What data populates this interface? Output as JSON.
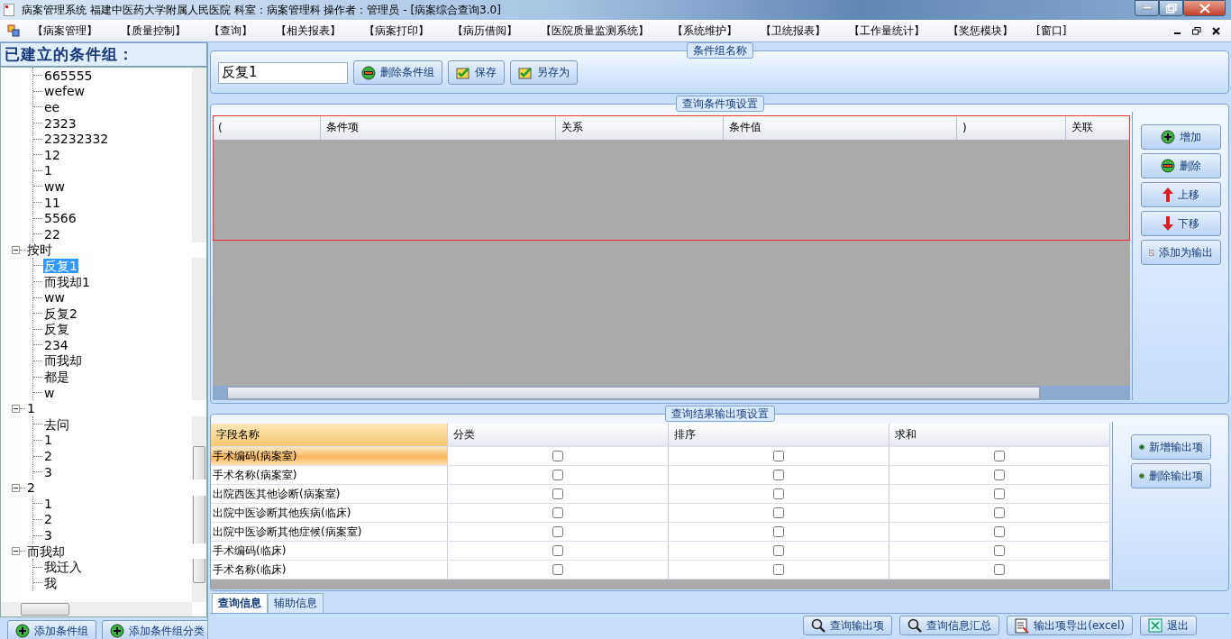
{
  "window": {
    "title": "病案管理系统  福建中医药大学附属人民医院  科室：病案管理科 操作者：管理员 - [病案综合查询3.0]"
  },
  "menu": [
    "【病案管理】",
    "【质量控制】",
    "【查询】",
    "【相关报表】",
    "【病案打印】",
    "【病历借阅】",
    "【医院质量监测系统】",
    "【系统维护】",
    "【卫统报表】",
    "【工作量统计】",
    "【奖惩模块】",
    "[窗口]"
  ],
  "left_panel": {
    "title": "已建立的条件组：",
    "tree": [
      {
        "expanded": true,
        "children": [
          {
            "label": "665555",
            "selected": false
          },
          {
            "label": "wefew",
            "selected": false
          },
          {
            "label": "ee",
            "selected": false
          },
          {
            "label": "2323",
            "selected": false
          },
          {
            "label": "23232332",
            "selected": false
          },
          {
            "label": "12",
            "selected": false
          },
          {
            "label": "1",
            "selected": false
          },
          {
            "label": "ww",
            "selected": false
          },
          {
            "label": "11",
            "selected": false
          },
          {
            "label": "5566",
            "selected": false
          },
          {
            "label": "22",
            "selected": false
          }
        ]
      },
      {
        "label": "按时",
        "expanded": true,
        "children": [
          {
            "label": "反复1",
            "selected": true
          },
          {
            "label": "而我却1",
            "selected": false
          },
          {
            "label": "ww",
            "selected": false
          },
          {
            "label": "反复2",
            "selected": false
          },
          {
            "label": "反复",
            "selected": false
          },
          {
            "label": "234",
            "selected": false
          },
          {
            "label": "而我却",
            "selected": false
          },
          {
            "label": "都是",
            "selected": false
          },
          {
            "label": "w",
            "selected": false
          }
        ]
      },
      {
        "label": "1",
        "expanded": true,
        "children": [
          {
            "label": "去问",
            "selected": false
          },
          {
            "label": "1",
            "selected": false
          },
          {
            "label": "2",
            "selected": false
          },
          {
            "label": "3",
            "selected": false
          }
        ]
      },
      {
        "label": "2",
        "expanded": true,
        "children": [
          {
            "label": "1",
            "selected": false
          },
          {
            "label": "2",
            "selected": false
          },
          {
            "label": "3",
            "selected": false
          }
        ]
      },
      {
        "label": "而我却",
        "expanded": true,
        "children": [
          {
            "label": "我迁入",
            "selected": false
          },
          {
            "label": "我",
            "selected": false
          }
        ]
      }
    ],
    "buttons": [
      {
        "label": "添加条件组",
        "kind": "plus"
      },
      {
        "label": "添加条件组分类",
        "kind": "plus"
      }
    ]
  },
  "group_name": {
    "legend": "条件组名称",
    "value": "反复1",
    "buttons": [
      {
        "label": "删除条件组",
        "kind": "minus"
      },
      {
        "label": "保存",
        "kind": "check"
      },
      {
        "label": "另存为",
        "kind": "check"
      }
    ]
  },
  "conditions": {
    "legend": "查询条件项设置",
    "columns": [
      "(",
      "条件项",
      "关系",
      "条件值",
      ")",
      "关联"
    ],
    "buttons": [
      {
        "label": "增加",
        "kind": "plus"
      },
      {
        "label": "删除",
        "kind": "minus"
      },
      {
        "label": "上移",
        "kind": "up"
      },
      {
        "label": "下移",
        "kind": "down"
      },
      {
        "label": "添加为输出",
        "kind": "export"
      }
    ]
  },
  "outputs": {
    "legend": "查询结果输出项设置",
    "columns": [
      "字段名称",
      "分类",
      "排序",
      "求和"
    ],
    "rows": [
      {
        "name": "手术编码(病案室)",
        "selected": true,
        "category": false,
        "sort": false,
        "sum": false
      },
      {
        "name": "手术名称(病案室)",
        "selected": false,
        "category": false,
        "sort": false,
        "sum": false
      },
      {
        "name": "出院西医其他诊断(病案室)",
        "selected": false,
        "category": false,
        "sort": false,
        "sum": false
      },
      {
        "name": "出院中医诊断其他疾病(临床)",
        "selected": false,
        "category": false,
        "sort": false,
        "sum": false
      },
      {
        "name": "出院中医诊断其他症候(病案室)",
        "selected": false,
        "category": false,
        "sort": false,
        "sum": false
      },
      {
        "name": "手术编码(临床)",
        "selected": false,
        "category": false,
        "sort": false,
        "sum": false
      },
      {
        "name": "手术名称(临床)",
        "selected": false,
        "category": false,
        "sort": false,
        "sum": false
      }
    ],
    "buttons": [
      {
        "label": "新增输出项",
        "kind": "plus"
      },
      {
        "label": "删除输出项",
        "kind": "minus"
      }
    ]
  },
  "tabs": [
    {
      "label": "查询信息",
      "selected": true
    },
    {
      "label": "辅助信息",
      "selected": false
    }
  ],
  "footer_buttons": [
    {
      "label": "查询输出项",
      "kind": "search"
    },
    {
      "label": "查询信息汇总",
      "kind": "search"
    },
    {
      "label": "输出项导出(excel)",
      "kind": "export"
    },
    {
      "label": "退出",
      "kind": "exit"
    }
  ]
}
